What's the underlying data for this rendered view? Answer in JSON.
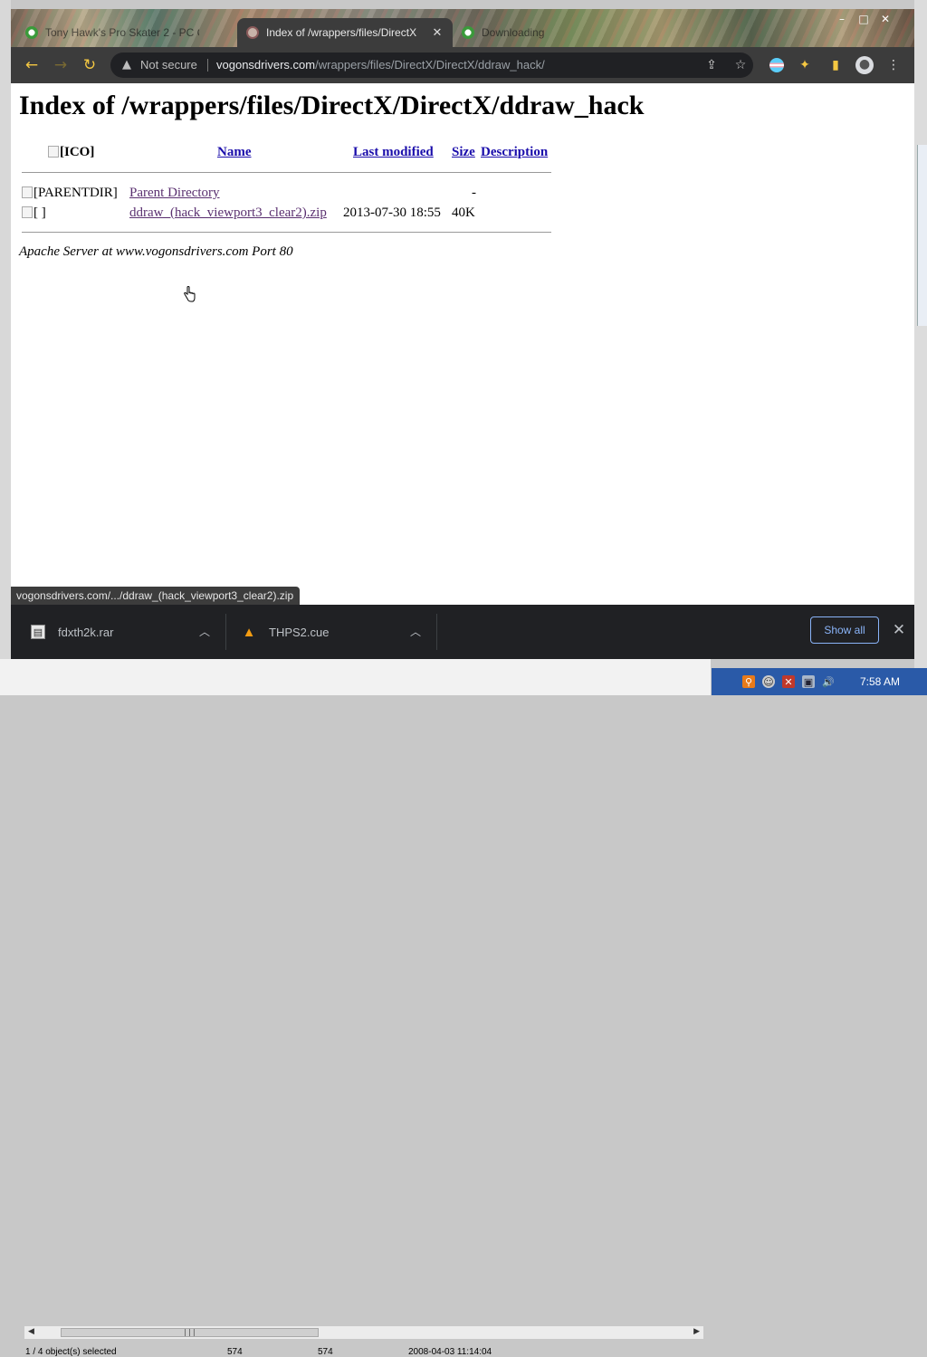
{
  "tabs": [
    {
      "title": "Tony Hawk's Pro Skater 2 - PC G",
      "state": "inactive",
      "icon": "green-favicon"
    },
    {
      "title": "Index of /wrappers/files/DirectX",
      "state": "active",
      "icon": "vogons-favicon"
    },
    {
      "title": "Downloading",
      "state": "inactive",
      "icon": "green-favicon"
    }
  ],
  "window_controls": {
    "minimize": "–",
    "maximize": "□",
    "close": "✕"
  },
  "toolbar": {
    "security_label": "Not secure",
    "url_host": "vogonsdrivers.com",
    "url_path": "/wrappers/files/DirectX/DirectX/ddraw_hack/"
  },
  "page": {
    "heading": "Index of /wrappers/files/DirectX/DirectX/ddraw_hack",
    "columns": {
      "ico": "[ICO]",
      "name": "Name",
      "modified": "Last modified",
      "size": "Size",
      "description": "Description"
    },
    "rows": [
      {
        "alt": "[PARENTDIR]",
        "name": "Parent Directory",
        "modified": "",
        "size": "-",
        "description": ""
      },
      {
        "alt": "[ ]",
        "name": "ddraw_(hack_viewport3_clear2).zip",
        "modified": "2013-07-30 18:55",
        "size": "40K",
        "description": ""
      }
    ],
    "address": "Apache Server at www.vogonsdrivers.com Port 80"
  },
  "status_url": "vogonsdrivers.com/.../ddraw_(hack_viewport3_clear2).zip",
  "downloads": [
    {
      "name": "fdxth2k.rar",
      "icon": "archive-icon"
    },
    {
      "name": "THPS2.cue",
      "icon": "vlc-cone-icon"
    }
  ],
  "shelf": {
    "show_all": "Show all"
  },
  "explorer_status": {
    "selected": "1 / 4 object(s) selected",
    "col1": "574",
    "col2": "574",
    "date": "2008-04-03 11:14:04"
  },
  "clock": "7:58 AM",
  "colors": {
    "toolbar": "#3c3c3c",
    "tab_strip_active": "#3c3c3c",
    "link": "#1a0dab",
    "shelf": "#202124",
    "accent_blue": "#8ab4f8",
    "taskbar": "#2a5aa8"
  }
}
